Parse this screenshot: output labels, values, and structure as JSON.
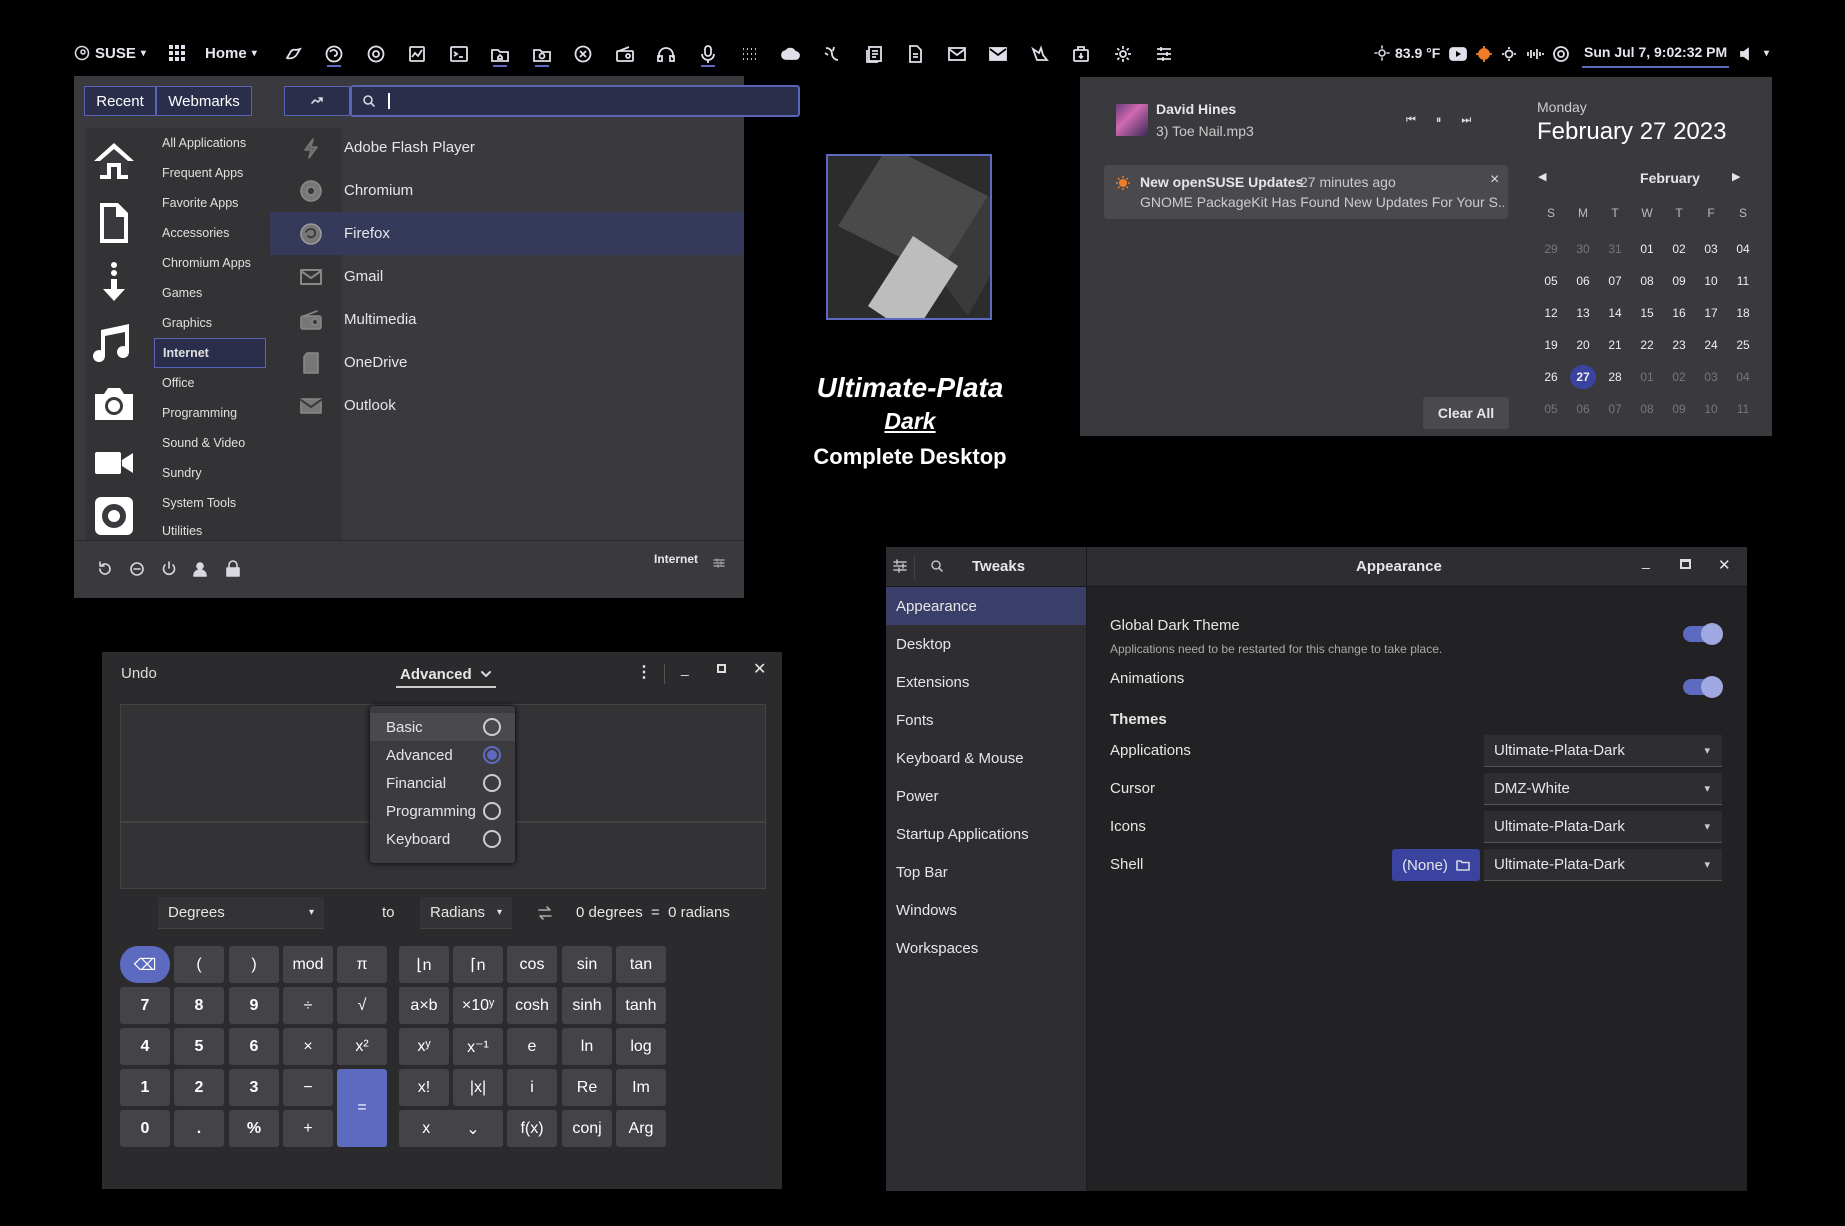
{
  "topbar": {
    "distro": "SUSE",
    "home": "Home",
    "weather": "83.9 °F",
    "clock": "Sun Jul  7, 9:02:32 PM"
  },
  "menu": {
    "tabs": [
      "Recent",
      "Webmarks"
    ],
    "search_value": "",
    "categories": [
      "All Applications",
      "Frequent Apps",
      "Favorite Apps",
      "Accessories",
      "Chromium Apps",
      "Games",
      "Graphics",
      "Internet",
      "Office",
      "Programming",
      "Sound & Video",
      "Sundry",
      "System Tools",
      "Utilities"
    ],
    "selected_category": "Internet",
    "apps": [
      "Adobe Flash Player",
      "Chromium",
      "Firefox",
      "Gmail",
      "Multimedia",
      "OneDrive",
      "Outlook"
    ],
    "footer_label": "Internet"
  },
  "brand": {
    "line1": "Ultimate-Plata",
    "line2": "Dark",
    "line3": "Complete Desktop"
  },
  "notif": {
    "artist": "David Hines",
    "track": "3) Toe Nail.mp3",
    "notif_title": "New openSUSE Updates",
    "notif_time": "27 minutes ago",
    "notif_body": "GNOME PackageKit Has Found New Updates For Your S...",
    "clear_all": "Clear All"
  },
  "calendar": {
    "weekday": "Monday",
    "date": "February 27 2023",
    "month": "February",
    "dow": [
      "S",
      "M",
      "T",
      "W",
      "T",
      "F",
      "S"
    ],
    "weeks": [
      [
        "29",
        "30",
        "31",
        "01",
        "02",
        "03",
        "04"
      ],
      [
        "05",
        "06",
        "07",
        "08",
        "09",
        "10",
        "11"
      ],
      [
        "12",
        "13",
        "14",
        "15",
        "16",
        "17",
        "18"
      ],
      [
        "19",
        "20",
        "21",
        "22",
        "23",
        "24",
        "25"
      ],
      [
        "26",
        "27",
        "28",
        "01",
        "02",
        "03",
        "04"
      ],
      [
        "05",
        "06",
        "07",
        "08",
        "09",
        "10",
        "11"
      ]
    ],
    "today": "27"
  },
  "calc": {
    "undo": "Undo",
    "mode": "Advanced",
    "modes": [
      "Basic",
      "Advanced",
      "Financial",
      "Programming",
      "Keyboard"
    ],
    "selected_mode": "Advanced",
    "from_unit": "Degrees",
    "to_label": "to",
    "to_unit": "Radians",
    "conversion": "0 degrees  =  0 radians",
    "rows": [
      [
        "⌫",
        "(",
        ")",
        "mod",
        "π",
        "⌊n",
        "⌈n",
        "cos",
        "sin",
        "tan"
      ],
      [
        "7",
        "8",
        "9",
        "÷",
        "√",
        "a×b",
        "×10ʸ",
        "cosh",
        "sinh",
        "tanh"
      ],
      [
        "4",
        "5",
        "6",
        "×",
        "x²",
        "xʸ",
        "x⁻¹",
        "e",
        "ln",
        "log"
      ],
      [
        "1",
        "2",
        "3",
        "−",
        "=",
        "x!",
        "|x|",
        "i",
        "Re",
        "Im"
      ],
      [
        "0",
        ".",
        "%",
        "+",
        "",
        "x",
        "",
        "f(x)",
        "conj",
        "Arg"
      ]
    ]
  },
  "tweaks": {
    "title": "Tweaks",
    "page_title": "Appearance",
    "nav": [
      "Appearance",
      "Desktop",
      "Extensions",
      "Fonts",
      "Keyboard & Mouse",
      "Power",
      "Startup Applications",
      "Top Bar",
      "Windows",
      "Workspaces"
    ],
    "global_dark": "Global Dark Theme",
    "global_dark_note": "Applications need to be restarted for this change to take place.",
    "animations": "Animations",
    "themes_heading": "Themes",
    "rows": [
      {
        "label": "Applications",
        "value": "Ultimate-Plata-Dark"
      },
      {
        "label": "Cursor",
        "value": "DMZ-White"
      },
      {
        "label": "Icons",
        "value": "Ultimate-Plata-Dark"
      },
      {
        "label": "Shell",
        "value": "Ultimate-Plata-Dark"
      }
    ],
    "shell_none": "(None)"
  },
  "colors": {
    "accent": "#5c6bc0",
    "panel": "#3a3a3e"
  }
}
